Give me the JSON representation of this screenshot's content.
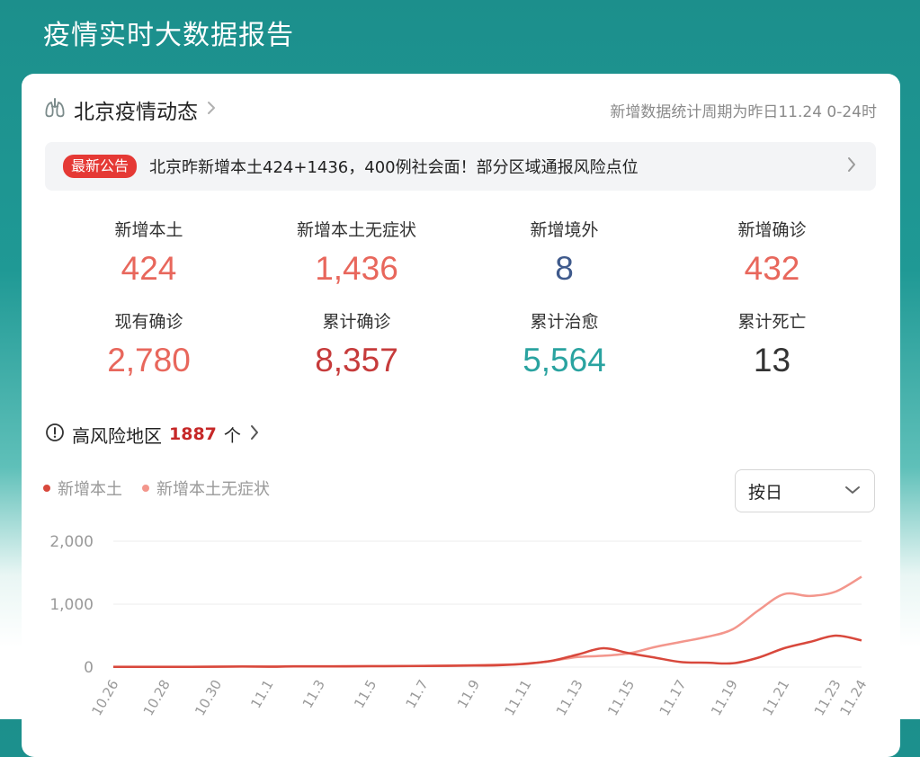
{
  "app": {
    "title": "疫情实时大数据报告"
  },
  "header": {
    "title": "北京疫情动态",
    "note": "新增数据统计周期为昨日11.24 0-24时"
  },
  "notice": {
    "badge": "最新公告",
    "text": "北京昨新增本土424+1436，400例社会面！部分区域通报风险点位"
  },
  "stats": [
    {
      "label": "新增本土",
      "value": "424",
      "color": "#e8675c"
    },
    {
      "label": "新增本土无症状",
      "value": "1,436",
      "color": "#e8675c"
    },
    {
      "label": "新增境外",
      "value": "8",
      "color": "#3f5a8c"
    },
    {
      "label": "新增确诊",
      "value": "432",
      "color": "#e8675c"
    },
    {
      "label": "现有确诊",
      "value": "2,780",
      "color": "#e8675c"
    },
    {
      "label": "累计确诊",
      "value": "8,357",
      "color": "#c63b3b"
    },
    {
      "label": "累计治愈",
      "value": "5,564",
      "color": "#2aa3a0"
    },
    {
      "label": "累计死亡",
      "value": "13",
      "color": "#333333"
    }
  ],
  "risk": {
    "label": "高风险地区",
    "count": "1887",
    "unit": "个"
  },
  "period_select": {
    "value": "按日"
  },
  "colors": {
    "series_local": "#d8483c",
    "series_asymptomatic": "#f3968c",
    "badge": "#e53935"
  },
  "chart_data": {
    "type": "line",
    "x": [
      "10.26",
      "10.27",
      "10.28",
      "10.29",
      "10.30",
      "10.31",
      "11.1",
      "11.2",
      "11.3",
      "11.4",
      "11.5",
      "11.6",
      "11.7",
      "11.8",
      "11.9",
      "11.10",
      "11.11",
      "11.12",
      "11.13",
      "11.14",
      "11.15",
      "11.16",
      "11.17",
      "11.18",
      "11.19",
      "11.20",
      "11.21",
      "11.22",
      "11.23",
      "11.24"
    ],
    "x_tick_labels": [
      "10.26",
      "10.28",
      "10.30",
      "11.1",
      "11.3",
      "11.5",
      "11.7",
      "11.9",
      "11.11",
      "11.13",
      "11.15",
      "11.17",
      "11.19",
      "11.21",
      "11.23",
      "11.24"
    ],
    "series": [
      {
        "name": "新增本土",
        "color": "#d8483c",
        "values": [
          3,
          3,
          4,
          3,
          5,
          8,
          6,
          10,
          10,
          12,
          14,
          16,
          18,
          20,
          25,
          30,
          55,
          100,
          200,
          300,
          220,
          150,
          80,
          70,
          60,
          150,
          300,
          400,
          500,
          424
        ]
      },
      {
        "name": "新增本土无症状",
        "color": "#f3968c",
        "values": [
          5,
          6,
          5,
          6,
          8,
          10,
          12,
          15,
          14,
          16,
          16,
          16,
          20,
          25,
          30,
          40,
          50,
          100,
          160,
          180,
          220,
          320,
          400,
          480,
          600,
          900,
          1160,
          1130,
          1200,
          1436
        ]
      }
    ],
    "y_ticks": [
      "2,000",
      "1,000",
      "0"
    ],
    "ylim": [
      0,
      2000
    ],
    "legend_position": "top-left",
    "grid": true
  }
}
